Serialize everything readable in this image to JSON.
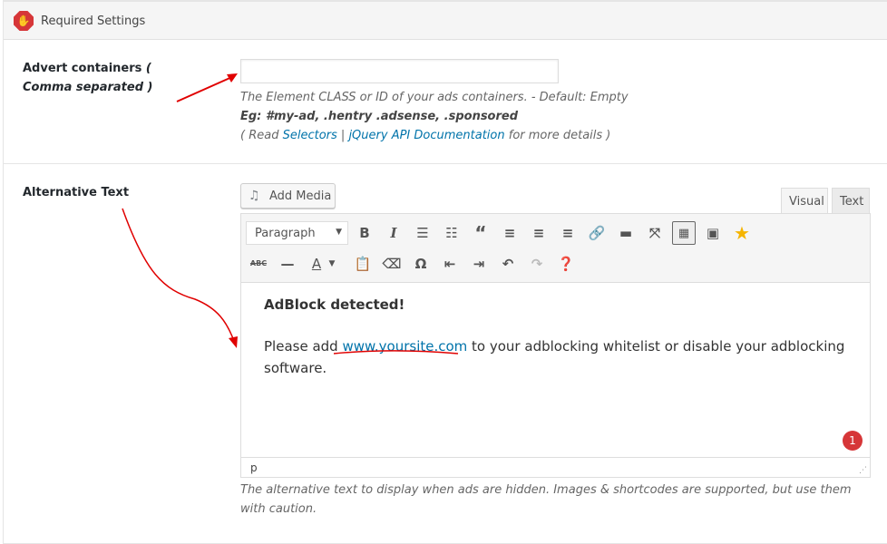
{
  "section": {
    "title": "Required Settings",
    "icon": "stop-hand-icon"
  },
  "advert": {
    "label": "Advert containers",
    "label_note": "( Comma separated )",
    "value": "",
    "placeholder": "",
    "desc1": "The Element CLASS or ID of your ads containers. - Default: Empty",
    "desc2": "Eg: #my-ad, .hentry .adsense, .sponsored",
    "desc3_pre": "( Read ",
    "link1": "Selectors",
    "sep": " | ",
    "link2": "jQuery API Documentation",
    "desc3_post": " for more details )"
  },
  "alt": {
    "label": "Alternative Text",
    "add_media": "Add Media",
    "tab_visual": "Visual",
    "tab_text": "Text",
    "format": "Paragraph",
    "heading": "AdBlock detected!",
    "body_pre": "Please add ",
    "body_link": "www.yoursite.com",
    "body_post": " to your adblocking whitelist or disable your adblocking software.",
    "status_path": "p",
    "badge": "1",
    "desc": "The alternative text to display when ads are hidden. Images & shortcodes are supported, but use them with caution."
  },
  "annotation_color": "#e00000"
}
